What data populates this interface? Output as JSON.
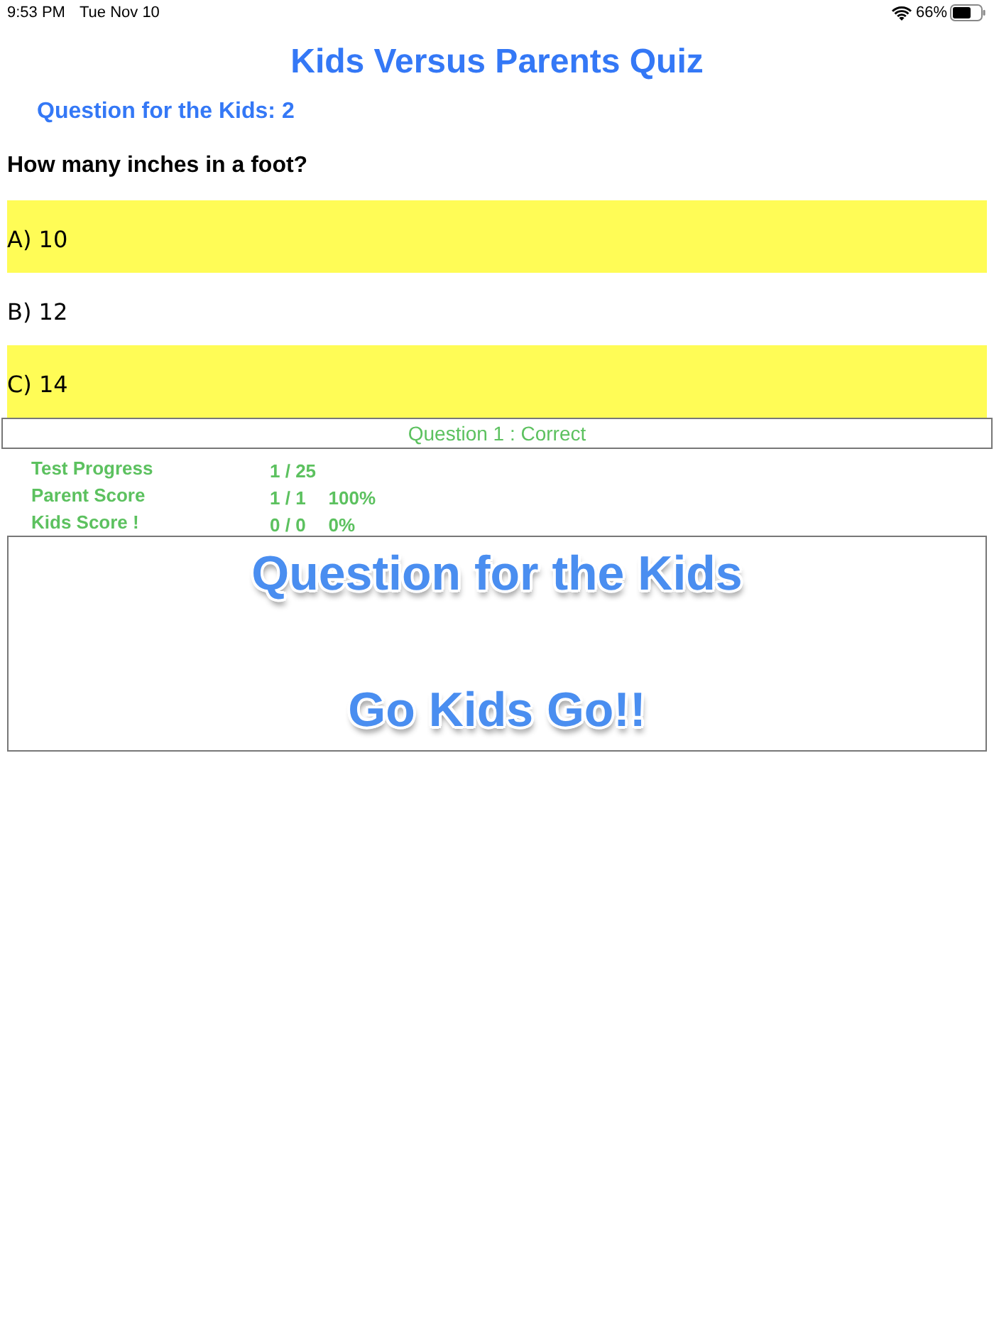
{
  "status_bar": {
    "time": "9:53 PM",
    "date": "Tue Nov 10",
    "battery": "66%"
  },
  "title": "Kids Versus Parents Quiz",
  "question_header": "Question for the Kids: 2",
  "question": "How many inches in a foot?",
  "answers": [
    {
      "label": "A) 10",
      "highlighted": true
    },
    {
      "label": "B) 12",
      "highlighted": false
    },
    {
      "label": "C) 14",
      "highlighted": true
    }
  ],
  "result": "Question 1 : Correct",
  "stats": [
    {
      "label": "Test Progress",
      "values": [
        "1 / 25"
      ]
    },
    {
      "label": "Parent Score",
      "values": [
        "1 / 1",
        "100%"
      ]
    },
    {
      "label": "Kids Score !",
      "values": [
        "0 / 0",
        "0%"
      ]
    }
  ],
  "banner": {
    "lines": [
      "Question for the Kids",
      "Go Kids Go!!"
    ]
  }
}
